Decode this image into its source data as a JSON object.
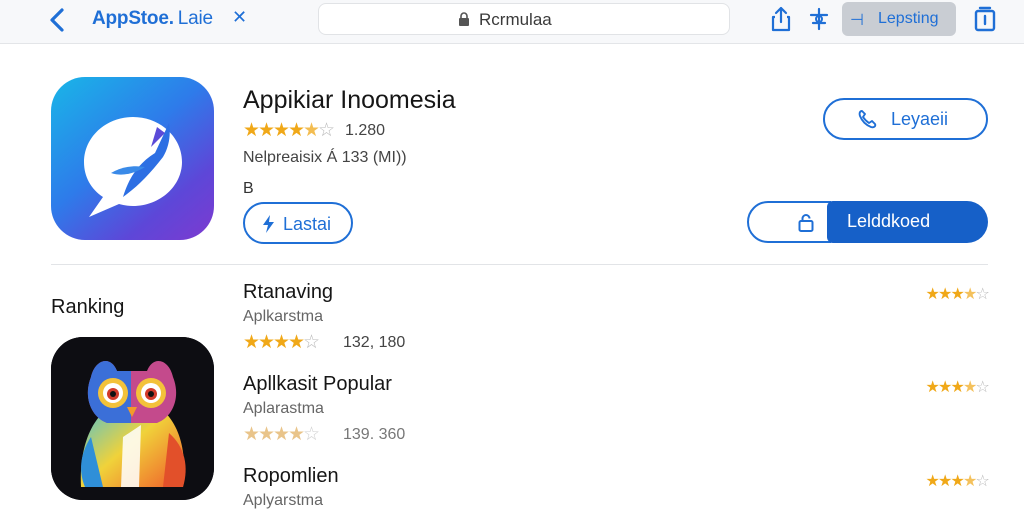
{
  "toolbar": {
    "brand": "AppStoe.",
    "brand_sub": "Laie",
    "close_glyph": "✕",
    "address": "Rcrmulaa",
    "segment_label": "Lepsting",
    "segment_icon": "⊣",
    "icons": {
      "back": "chevron-left-icon",
      "lock": "lock-icon",
      "share": "share-icon",
      "tool": "puzzle-icon",
      "tabs": "tabs-icon"
    }
  },
  "app": {
    "title": "Appikiar Inoomesia",
    "rating": 4.5,
    "rating_count": "1.280",
    "developer_line": "Nelpreaisix Á 133 (MI))",
    "small_label": "B",
    "left_button": "Lastai",
    "call_button": "Leyaeii",
    "action_button": "Lelddkoed"
  },
  "ranking": {
    "section_title": "Ranking",
    "items": [
      {
        "title": "Rtanaving",
        "subtitle": "Aplkarstma",
        "stars": 4,
        "count": "132, 180",
        "right_stars": 3.5,
        "faded": false
      },
      {
        "title": "Apllkasit Popular",
        "subtitle": "Aplarastma",
        "stars": 4,
        "count": "139. 360",
        "right_stars": 3.5,
        "faded": true
      },
      {
        "title": "Ropomlien",
        "subtitle": "Aplyarstma",
        "stars": null,
        "count": "",
        "right_stars": 3.5,
        "faded": false
      }
    ]
  },
  "colors": {
    "accent": "#1f6fd6",
    "action_fill": "#1660c8",
    "star": "#f0a818"
  }
}
